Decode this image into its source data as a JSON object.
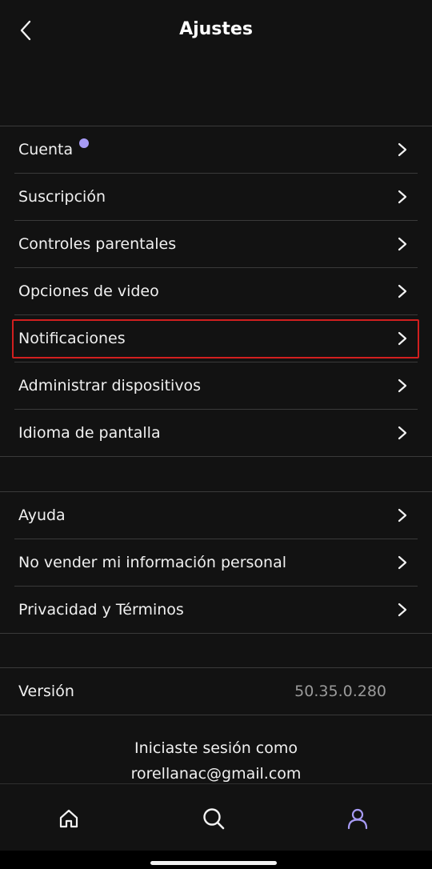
{
  "header": {
    "title": "Ajustes"
  },
  "group1": [
    {
      "label": "Cuenta"
    },
    {
      "label": "Suscripción"
    },
    {
      "label": "Controles parentales"
    },
    {
      "label": "Opciones de video"
    },
    {
      "label": "Notificaciones"
    },
    {
      "label": "Administrar dispositivos"
    },
    {
      "label": "Idioma de pantalla"
    }
  ],
  "group2": [
    {
      "label": "Ayuda"
    },
    {
      "label": "No vender mi información personal"
    },
    {
      "label": "Privacidad y Términos"
    }
  ],
  "version": {
    "label": "Versión",
    "value": "50.35.0.280"
  },
  "signed_in": {
    "line1": "Iniciaste sesión como",
    "email": "rorellanac@gmail.com"
  },
  "colors": {
    "background": "#121212",
    "accent": "#a79bf5",
    "highlight": "#d11f1f",
    "divider": "#3a3a3a"
  },
  "icons": {
    "back": "chevron-left-icon",
    "row": "chevron-right-icon",
    "home": "home-icon",
    "search": "search-icon",
    "profile": "profile-icon"
  }
}
